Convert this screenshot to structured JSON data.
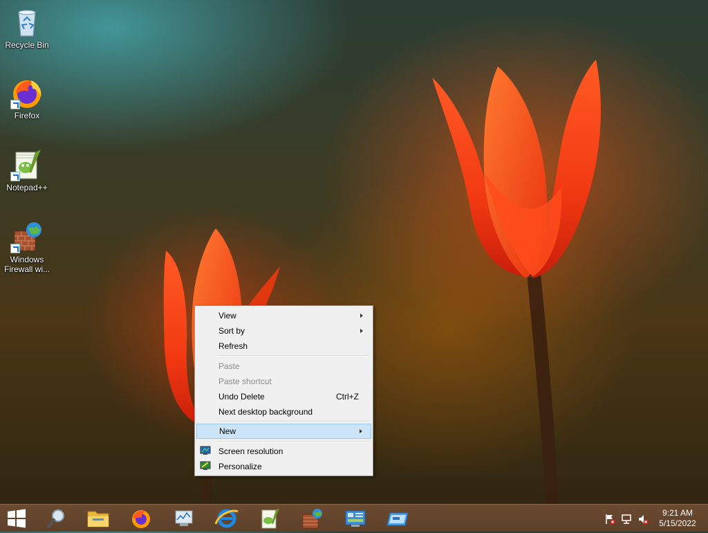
{
  "desktop": {
    "icons": [
      {
        "label": "Recycle Bin",
        "icon": "recycle-bin-icon"
      },
      {
        "label": "Firefox",
        "icon": "firefox-icon"
      },
      {
        "label": "Notepad++",
        "icon": "notepadpp-icon"
      },
      {
        "label_line1": "Windows",
        "label_line2": "Firewall wi...",
        "icon": "firewall-icon"
      }
    ]
  },
  "context_menu": {
    "items": [
      {
        "label": "View",
        "submenu": true
      },
      {
        "label": "Sort by",
        "submenu": true
      },
      {
        "label": "Refresh"
      },
      {
        "label": "Paste",
        "disabled": true
      },
      {
        "label": "Paste shortcut",
        "disabled": true
      },
      {
        "label": "Undo Delete",
        "shortcut": "Ctrl+Z"
      },
      {
        "label": "Next desktop background"
      },
      {
        "label": "New",
        "submenu": true,
        "highlighted": true
      },
      {
        "label": "Screen resolution",
        "icon": "screen-resolution-icon"
      },
      {
        "label": "Personalize",
        "icon": "personalize-icon"
      }
    ]
  },
  "taskbar": {
    "buttons": [
      "start-icon",
      "search-icon",
      "file-explorer-icon",
      "firefox-icon",
      "performance-monitor-icon",
      "internet-explorer-icon",
      "notepadpp-icon",
      "firewall-icon",
      "control-panel-icon",
      "remote-desktop-icon"
    ],
    "tray_icons": [
      "action-center-flag-icon",
      "network-icon",
      "volume-muted-icon"
    ],
    "clock": {
      "time": "9:21 AM",
      "date": "5/15/2022"
    }
  },
  "colors": {
    "menu_bg": "#f0f0f0",
    "menu_highlight": "#cce4f7",
    "taskbar": "#5e4029"
  }
}
